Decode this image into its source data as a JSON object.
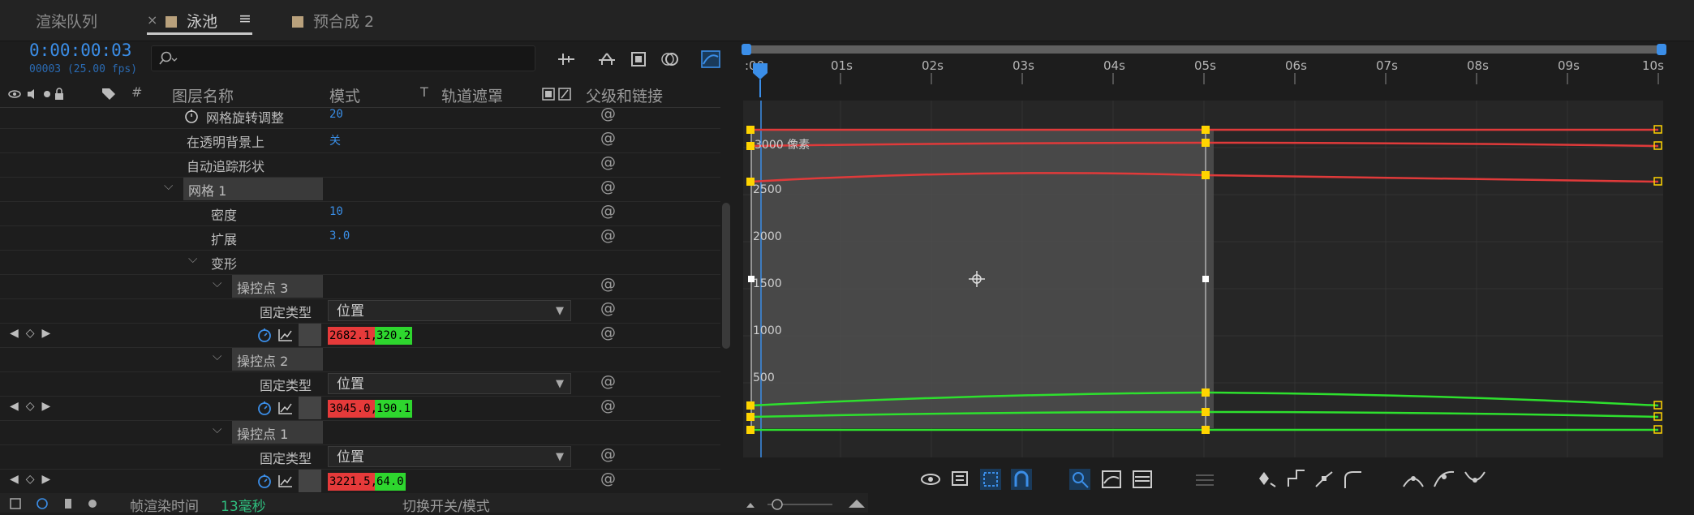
{
  "tabs": [
    {
      "label": "渲染队列"
    },
    {
      "label": "泳池"
    },
    {
      "label": "预合成 2"
    }
  ],
  "tab_close": "×",
  "tab_menu": "≡",
  "timecode": "0:00:00:03",
  "timecode_sub": "00003 (25.00 fps)",
  "search_icon": "search-icon",
  "columns": {
    "num": "#",
    "layer_name": "图层名称",
    "mode": "模式",
    "t": "T",
    "track_matte": "轨道遮罩",
    "parent": "父级和链接"
  },
  "rows": [
    {
      "label": "网格旋转调整",
      "value": "20"
    },
    {
      "label": "在透明背景上",
      "value": "关"
    },
    {
      "label": "自动追踪形状"
    },
    {
      "label": "网格 1"
    },
    {
      "label": "密度",
      "value": "10"
    },
    {
      "label": "扩展",
      "value": "3.0"
    },
    {
      "label": "变形"
    },
    {
      "label": "操控点 3"
    },
    {
      "label": "固定类型",
      "dropdown": "位置"
    },
    {
      "x": "2682.1,",
      "y": "320.2"
    },
    {
      "label": "操控点 2"
    },
    {
      "label": "固定类型",
      "dropdown": "位置"
    },
    {
      "x": "3045.0,",
      "y": "190.1"
    },
    {
      "label": "操控点 1"
    },
    {
      "label": "固定类型",
      "dropdown": "位置"
    },
    {
      "x": "3221.5,",
      "y": "64.0"
    }
  ],
  "time_ticks": [
    ":00",
    "01s",
    "02s",
    "03s",
    "04s",
    "05s",
    "06s",
    "07s",
    "08s",
    "09s",
    "10s"
  ],
  "graph": {
    "unit_label": "3000 像素",
    "y_ticks": [
      "2500",
      "2000",
      "1500",
      "1000",
      "500"
    ],
    "red_color": "#e03a3a",
    "green_color": "#2ee02e",
    "key_color": "#ffd400"
  },
  "status": {
    "render_time_label": "帧渲染时间",
    "render_time_value": "13毫秒",
    "toggle_label": "切换开关/模式"
  }
}
